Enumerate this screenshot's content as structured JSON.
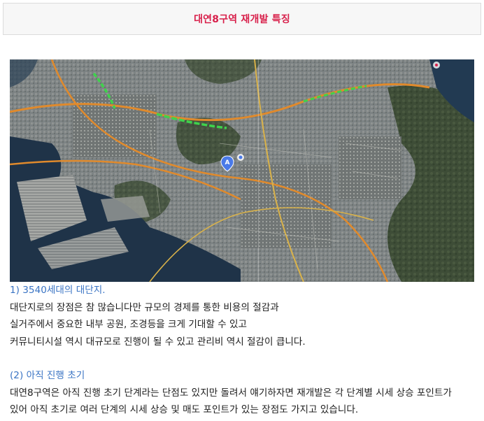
{
  "header": {
    "title": "대연8구역 재개발 특징"
  },
  "map": {
    "icons": [
      "map-pin-icon",
      "map-marker-icon",
      "map-poi-icon"
    ],
    "marker_letter": "A",
    "colors": {
      "water": "#1f3348",
      "land": "#4b5744",
      "urban": "#7f8586",
      "road": "#e08a2c",
      "traffic": "#3fd24c"
    }
  },
  "sections": [
    {
      "heading": "1) 3540세대의 대단지.",
      "lines": [
        "대단지로의 장점은 참 많습니다만 규모의 경제를 통한 비용의 절감과",
        "실거주에서 중요한 내부 공원, 조경등을 크게 기대할 수 있고",
        "커뮤니티시설 역시 대규모로 진행이 될 수 있고 관리비 역시 절감이 큽니다."
      ]
    },
    {
      "heading": "(2) 아직 진행 초기",
      "lines": [
        "대연8구역은 아직 진행 초기 단계라는 단점도 있지만 돌려서 얘기하자면 재개발은 각 단계별 시세 상승 포인트가",
        "있어 아직 초기로 여러 단계의 시세 상승 및 매도 포인트가 있는 장점도 가지고 있습니다."
      ]
    }
  ],
  "colors": {
    "title": "#d8204b",
    "heading": "#3a74c4",
    "text": "#1e1e1e"
  }
}
